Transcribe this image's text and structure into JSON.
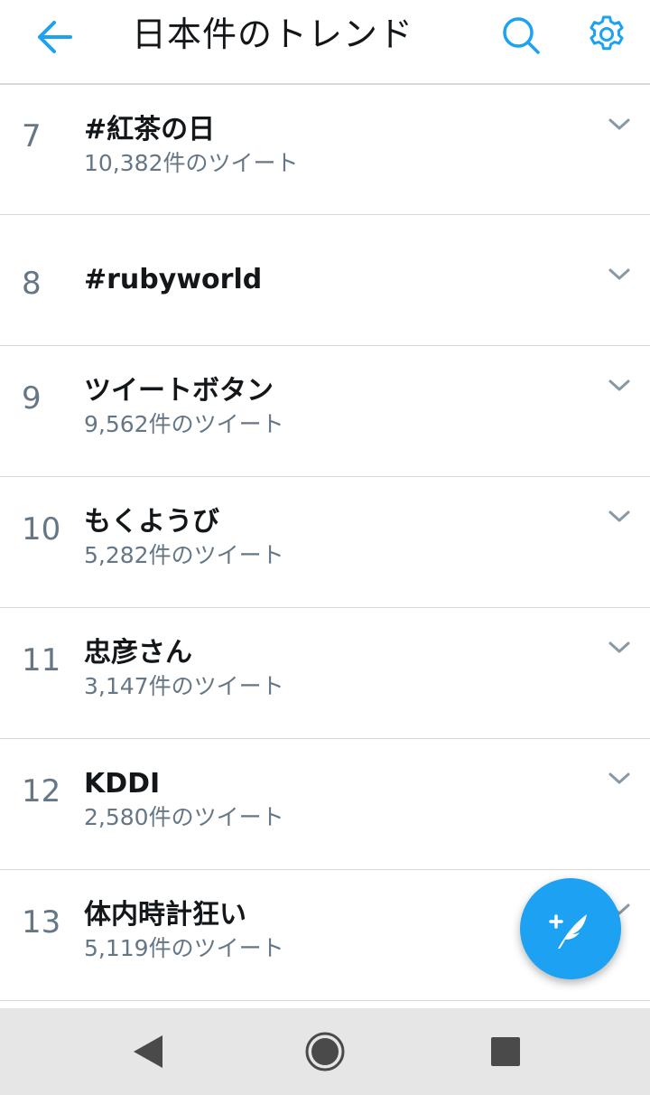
{
  "header": {
    "title": "日本件のトレンド",
    "back_icon": "arrow-left-icon",
    "search_icon": "search-icon",
    "settings_icon": "gear-icon"
  },
  "trends": [
    {
      "rank": "7",
      "name": "#紅茶の日",
      "count": "10,382件のツイート"
    },
    {
      "rank": "8",
      "name": "#rubyworld",
      "count": ""
    },
    {
      "rank": "9",
      "name": "ツイートボタン",
      "count": "9,562件のツイート"
    },
    {
      "rank": "10",
      "name": "もくようび",
      "count": "5,282件のツイート"
    },
    {
      "rank": "11",
      "name": "忠彦さん",
      "count": "3,147件のツイート"
    },
    {
      "rank": "12",
      "name": "KDDI",
      "count": "2,580件のツイート"
    },
    {
      "rank": "13",
      "name": "体内時計狂い",
      "count": "5,119件のツイート"
    }
  ],
  "fab": {
    "icon": "compose-tweet-icon"
  },
  "navbar": {
    "back_icon": "nav-back-icon",
    "home_icon": "nav-home-icon",
    "recent_icon": "nav-recent-icon"
  },
  "colors": {
    "accent": "#1da1f2",
    "text": "#14171a",
    "muted": "#657786",
    "divider": "#cfd9de",
    "navbar": "#e6e6e6"
  }
}
